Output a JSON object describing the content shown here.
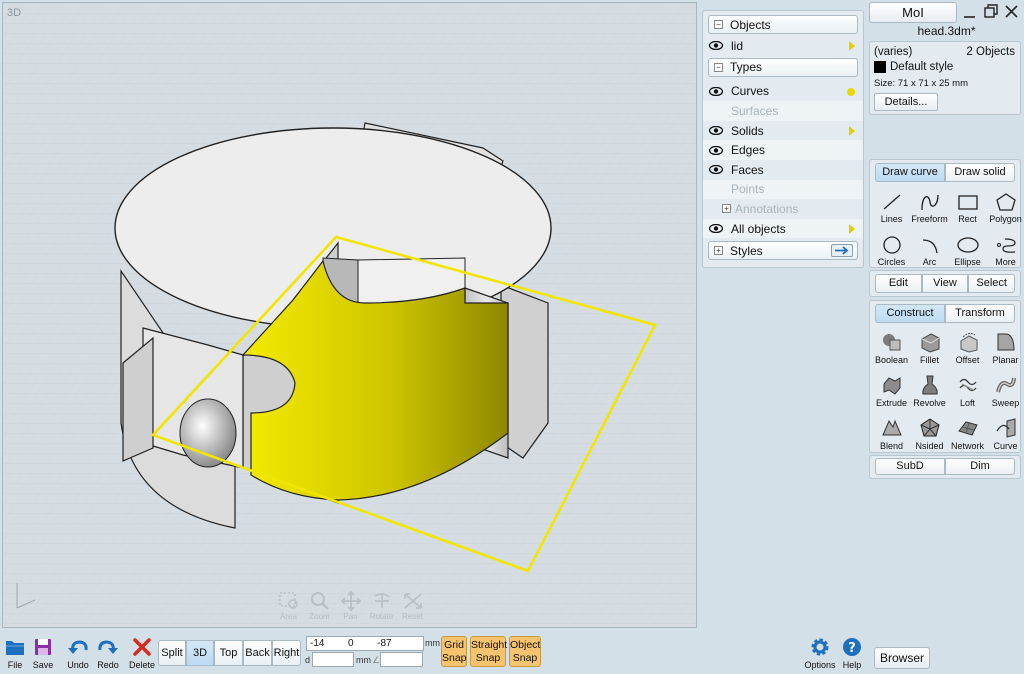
{
  "viewport": {
    "label": "3D",
    "nav_tools": [
      {
        "label": "Area",
        "icon": "area-zoom-icon"
      },
      {
        "label": "Zoom",
        "icon": "zoom-icon"
      },
      {
        "label": "Pan",
        "icon": "pan-icon"
      },
      {
        "label": "Rotate",
        "icon": "rotate-icon"
      },
      {
        "label": "Reset",
        "icon": "reset-view-icon"
      }
    ]
  },
  "scene_panel": {
    "objects_header": "Objects",
    "objects": [
      {
        "label": "lid",
        "visible": true
      }
    ],
    "types_header": "Types",
    "types": [
      {
        "label": "Curves",
        "visible": true
      },
      {
        "label": "Surfaces",
        "visible": false
      },
      {
        "label": "Solids",
        "visible": true
      },
      {
        "label": "Edges",
        "visible": true
      },
      {
        "label": "Faces",
        "visible": true
      },
      {
        "label": "Points",
        "visible": false
      }
    ],
    "annotations_label": "Annotations",
    "all_objects_label": "All objects",
    "styles_header": "Styles"
  },
  "app": {
    "name": "MoI",
    "file_name": "head.3dm*"
  },
  "properties": {
    "varies": "(varies)",
    "count": "2 Objects",
    "style": "Default style",
    "size": "Size: 71 x 71 x 25 mm",
    "details_button": "Details..."
  },
  "draw": {
    "tab_curve": "Draw curve",
    "tab_solid": "Draw solid",
    "tools": [
      {
        "label": "Lines",
        "icon": "lines-icon"
      },
      {
        "label": "Freeform",
        "icon": "freeform-icon"
      },
      {
        "label": "Rect",
        "icon": "rectangle-icon"
      },
      {
        "label": "Polygon",
        "icon": "polygon-icon"
      },
      {
        "label": "Circles",
        "icon": "circle-icon"
      },
      {
        "label": "Arc",
        "icon": "arc-icon"
      },
      {
        "label": "Ellipse",
        "icon": "ellipse-icon"
      },
      {
        "label": "More",
        "icon": "more-icon"
      }
    ]
  },
  "edit_tabs": {
    "edit": "Edit",
    "view": "View",
    "select": "Select"
  },
  "construct": {
    "tab_construct": "Construct",
    "tab_transform": "Transform",
    "tools": [
      {
        "label": "Boolean",
        "icon": "boolean-icon"
      },
      {
        "label": "Fillet",
        "icon": "fillet-icon"
      },
      {
        "label": "Offset",
        "icon": "offset-icon"
      },
      {
        "label": "Planar",
        "icon": "planar-icon"
      },
      {
        "label": "Extrude",
        "icon": "extrude-icon"
      },
      {
        "label": "Revolve",
        "icon": "revolve-icon"
      },
      {
        "label": "Loft",
        "icon": "loft-icon"
      },
      {
        "label": "Sweep",
        "icon": "sweep-icon"
      },
      {
        "label": "Blend",
        "icon": "blend-icon"
      },
      {
        "label": "Nsided",
        "icon": "nsided-icon"
      },
      {
        "label": "Network",
        "icon": "network-icon"
      },
      {
        "label": "Curve",
        "icon": "curve-icon"
      }
    ],
    "subd": "SubD",
    "dim": "Dim"
  },
  "toolbar": {
    "file": "File",
    "save": "Save",
    "undo": "Undo",
    "redo": "Redo",
    "delete": "Delete",
    "views": [
      "Split",
      "3D",
      "Top",
      "Back",
      "Right"
    ],
    "active_view": "3D",
    "coord_x": "-14",
    "coord_y": "0",
    "coord_z": "-87",
    "unit": "mm",
    "d_label": "d",
    "d_unit": "mm",
    "grid_snap": [
      "Grid",
      "Snap"
    ],
    "straight_snap": [
      "Straight",
      "Snap"
    ],
    "object_snap": [
      "Object",
      "Snap"
    ],
    "options": "Options",
    "help": "Help",
    "browser": "Browser"
  },
  "colors": {
    "accent_yellow": "#e3dc00",
    "snap_orange": "#f6c36e",
    "icon_blue": "#1f6fbf",
    "delete_red": "#d62b1f"
  }
}
